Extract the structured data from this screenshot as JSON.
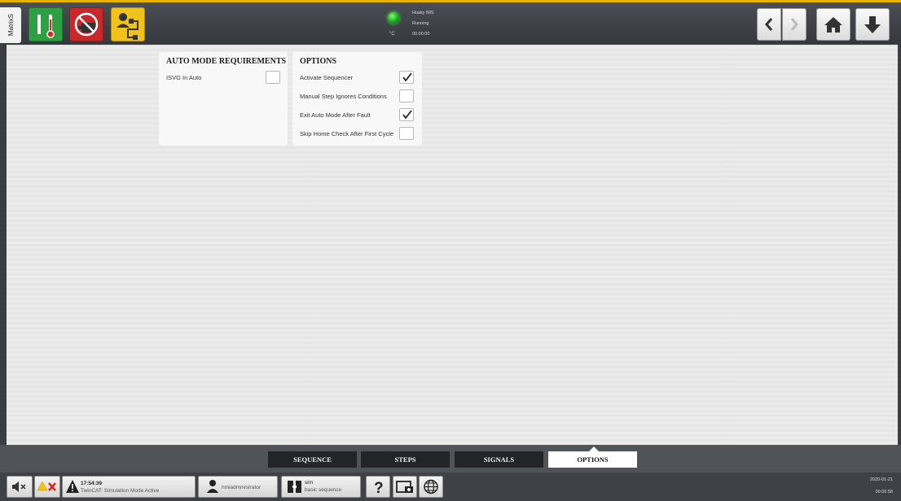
{
  "topbar": {
    "side_tab_label": "MatrixS",
    "status": {
      "unit": "°C",
      "line1": "Husky IMS",
      "line2": "Running",
      "line3": "00:00:00"
    }
  },
  "auto_requirements": {
    "title": "AUTO MODE REQUIREMENTS",
    "items": [
      {
        "label": "ISVG In Auto",
        "checked": false
      }
    ]
  },
  "options": {
    "title": "OPTIONS",
    "items": [
      {
        "label": "Activate Sequencer",
        "checked": true
      },
      {
        "label": "Manual Step Ignores Conditions",
        "checked": false
      },
      {
        "label": "Exit Auto Mode After Fault",
        "checked": true
      },
      {
        "label": "Skip Home Check After First Cycle",
        "checked": false
      }
    ]
  },
  "tabs": [
    {
      "label": "SEQUENCE",
      "active": false
    },
    {
      "label": "STEPS",
      "active": false
    },
    {
      "label": "SIGNALS",
      "active": false
    },
    {
      "label": "OPTIONS",
      "active": true
    }
  ],
  "bottombar": {
    "alarm_time": "17:54:39",
    "alarm_text": "TwinCAT: Simulation Mode Active",
    "user": "hmiadministrator",
    "sequence_title": "sim",
    "sequence_subtitle": "basic sequence",
    "date": "2020-01-21",
    "time": "00:06:58"
  },
  "colors": {
    "accent": "#e8b400",
    "green_button": "#2ea043",
    "red_button": "#c8282a",
    "yellow_button": "#f1c21b"
  }
}
